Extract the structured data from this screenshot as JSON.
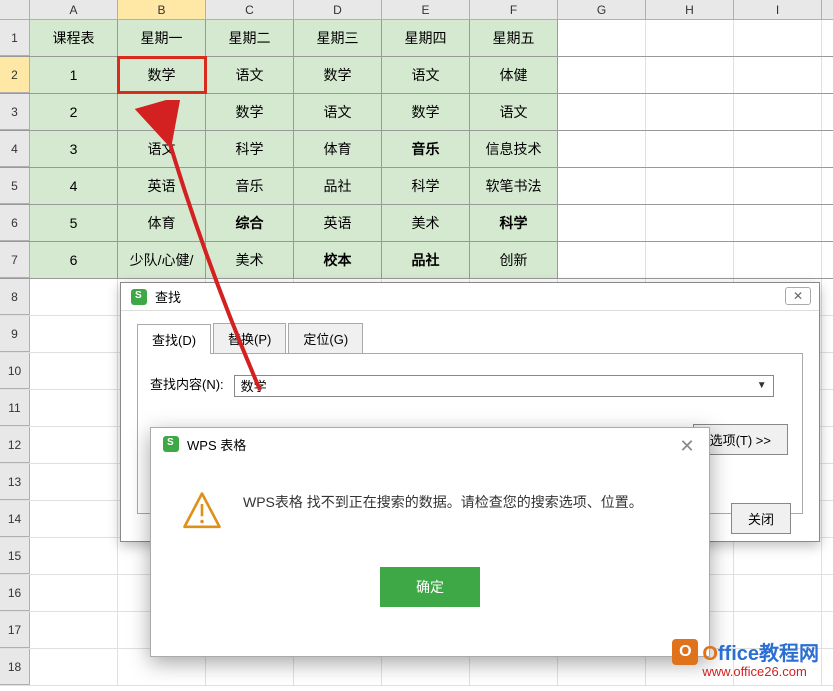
{
  "columns": [
    "A",
    "B",
    "C",
    "D",
    "E",
    "F",
    "G",
    "H",
    "I"
  ],
  "row_count": 18,
  "selected_col": "B",
  "selected_row": 2,
  "highlighted_cell": {
    "row": 2,
    "col": "B"
  },
  "table": {
    "header_row": [
      "课程表",
      "星期一",
      "星期二",
      "星期三",
      "星期四",
      "星期五"
    ],
    "rows": [
      {
        "label": "1",
        "cells": [
          "数学",
          "语文",
          "数学",
          "语文",
          "体健"
        ],
        "bold": []
      },
      {
        "label": "2",
        "cells": [
          "语文",
          "数学",
          "语文",
          "数学",
          "语文"
        ],
        "bold": []
      },
      {
        "label": "3",
        "cells": [
          "语文",
          "科学",
          "体育",
          "音乐",
          "信息技术"
        ],
        "bold": [
          2
        ]
      },
      {
        "label": "4",
        "cells": [
          "英语",
          "音乐",
          "品社",
          "科学",
          "软笔书法"
        ],
        "bold": []
      },
      {
        "label": "5",
        "cells": [
          "体育",
          "综合",
          "英语",
          "美术",
          "科学"
        ],
        "bold": [
          0,
          3
        ]
      },
      {
        "label": "6",
        "cells": [
          "少队/心健/",
          "美术",
          "校本",
          "品社",
          "创新"
        ],
        "bold": [
          1,
          2
        ]
      }
    ]
  },
  "find_dialog": {
    "title": "查找",
    "tabs": {
      "find": "查找(D)",
      "replace": "替换(P)",
      "goto": "定位(G)"
    },
    "active_tab": "find",
    "label": "查找内容(N):",
    "value": "数学",
    "options_btn": "选项(T) >>",
    "close_btn": "关闭"
  },
  "alert_dialog": {
    "title": "WPS 表格",
    "message": "WPS表格 找不到正在搜索的数据。请检查您的搜索选项、位置。",
    "ok": "确定"
  },
  "watermark": {
    "brand_prefix": "O",
    "brand_mid": "ffice",
    "brand_suffix": "教程网",
    "url": "www.office26.com"
  }
}
